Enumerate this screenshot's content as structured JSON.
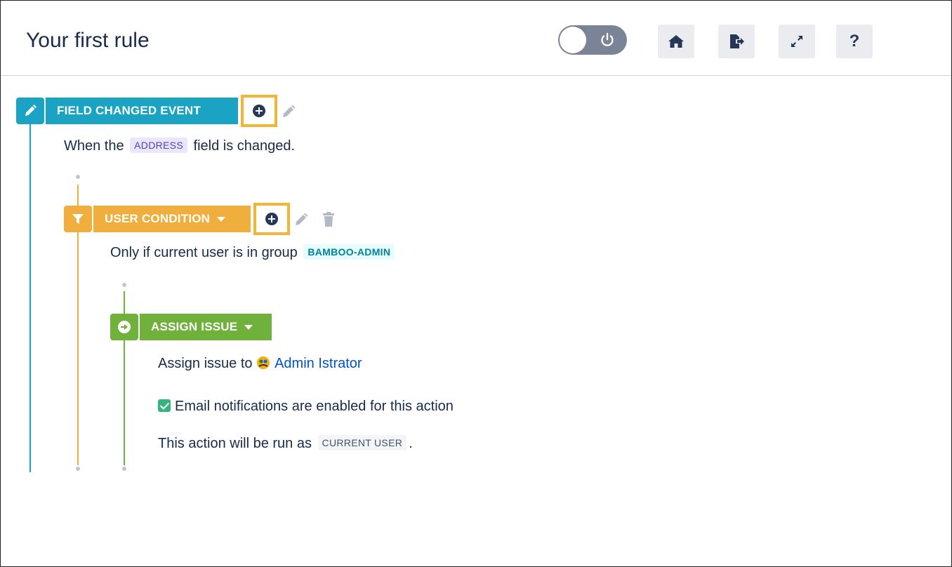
{
  "header": {
    "title": "Your first rule",
    "toggle_state": "off",
    "tools": [
      "home-icon",
      "export-icon",
      "expand-icon",
      "help-icon"
    ],
    "help_label": "?"
  },
  "trigger": {
    "label": "FIELD CHANGED EVENT",
    "color": "#1aa3c2",
    "description_pre": "When the",
    "field_tag": "ADDRESS",
    "description_post": "field is changed."
  },
  "condition": {
    "label": "USER CONDITION",
    "color": "#f0ae3c",
    "description_pre": "Only if current user is in group",
    "group_tag": "BAMBOO-ADMIN"
  },
  "action": {
    "label": "ASSIGN ISSUE",
    "color": "#6fb13b",
    "assign_pre": "Assign issue to",
    "assignee": "Admin Istrator",
    "email_note": "Email notifications are enabled for this action",
    "run_as_pre": "This action will be run as",
    "run_as_tag": "CURRENT USER",
    "run_as_post": "."
  },
  "colors": {
    "highlight": "#f5b534",
    "trigger_line": "#1aa3c2",
    "condition_line": "#f0ae3c",
    "action_line": "#6fb13b"
  }
}
